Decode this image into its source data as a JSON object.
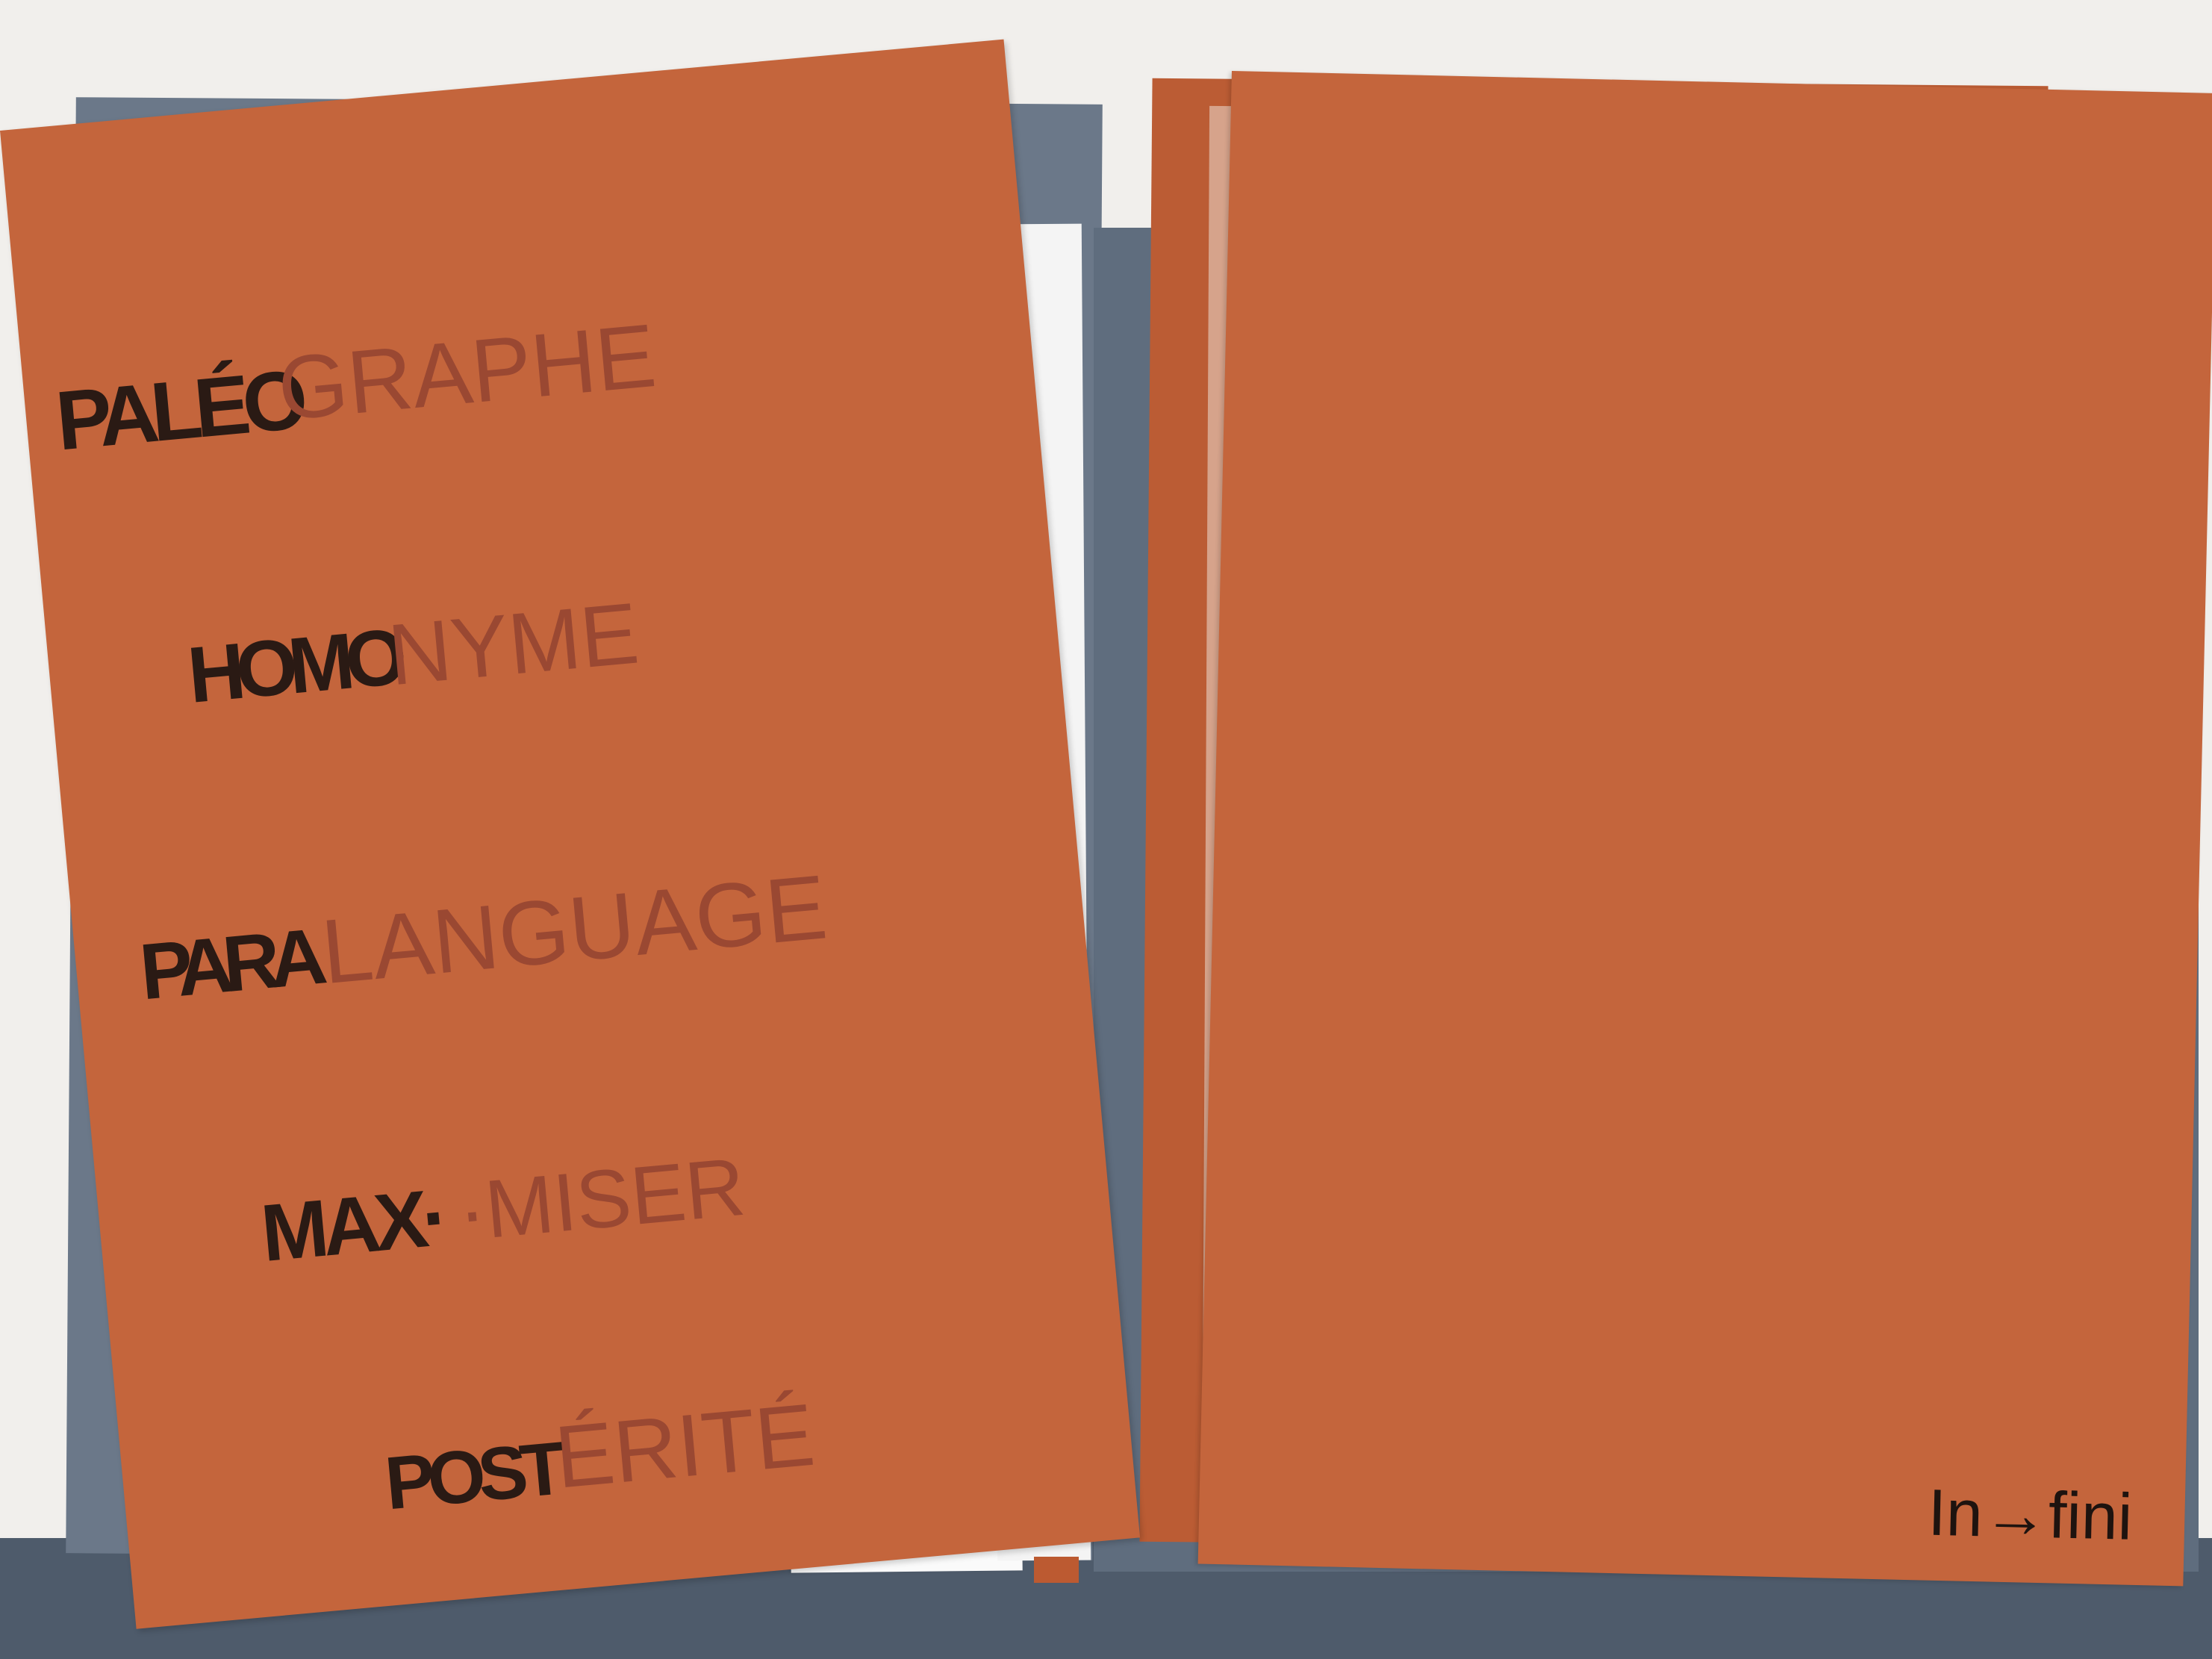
{
  "scene": {
    "description_free": true,
    "colors": {
      "background": "#f1efec",
      "folder_slate": "#5f6d7e",
      "folder_slate_dark": "#4e5b6b",
      "card_orange": "#c2643b",
      "card_orange_shadow": "#a9532f",
      "white_sheet": "#f7f7f7",
      "vellum": "#d9a48a"
    }
  },
  "left_card": {
    "words": [
      {
        "prefix": "PALÉO",
        "suffix": "GRAPHE"
      },
      {
        "prefix": "HOMO",
        "suffix": "NYME"
      },
      {
        "prefix": "PARA",
        "suffix": "LANGUAGE"
      },
      {
        "prefix": "MAX·",
        "suffix": "·MISER"
      },
      {
        "prefix": "POST",
        "suffix": "ÉRITÉ"
      }
    ]
  },
  "right_card": {
    "label": "In→fini"
  }
}
